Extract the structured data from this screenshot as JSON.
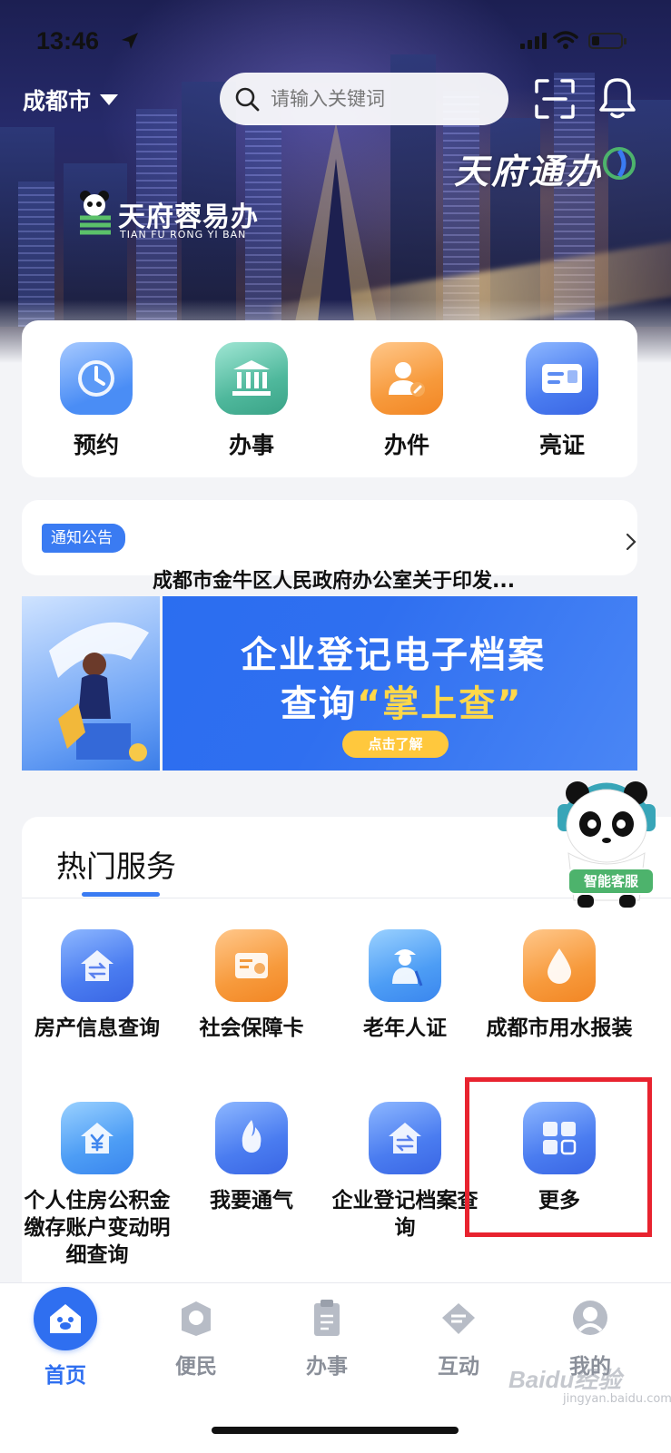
{
  "status_bar": {
    "time": "13:46",
    "battery_level": 0.25
  },
  "header": {
    "city": "成都市",
    "search_placeholder": "请输入关键词",
    "brand_logo": "天府通办",
    "sub_logo_main": "天府蓉易办",
    "sub_logo_sub": "TIAN FU RONG YI BAN"
  },
  "quick_actions": [
    {
      "label": "预约",
      "icon": "clock-icon",
      "color": "#4a8df5"
    },
    {
      "label": "办事",
      "icon": "bank-icon",
      "color": "#3fae8f"
    },
    {
      "label": "办件",
      "icon": "person-stamp-icon",
      "color": "#f28a2c"
    },
    {
      "label": "亮证",
      "icon": "id-card-icon",
      "color": "#4a7cf0"
    }
  ],
  "notice": {
    "badge": "通知公告",
    "text": "成都市金牛区人民政府办公室关于印发..."
  },
  "banner": {
    "line1": "企业登记电子档案",
    "line2_prefix": "查询",
    "line2_highlight": "“掌上查”",
    "button": "点击了解"
  },
  "hot_services": {
    "title": "热门服务",
    "items": [
      {
        "label": "房产信息查询",
        "icon": "house-exchange-icon"
      },
      {
        "label": "社会保障卡",
        "icon": "social-card-icon"
      },
      {
        "label": "老年人证",
        "icon": "elder-icon"
      },
      {
        "label": "成都市用水报装",
        "icon": "water-drop-icon"
      },
      {
        "label": "个人住房公积金缴存账户变动明细查询",
        "icon": "housing-fund-icon"
      },
      {
        "label": "我要通气",
        "icon": "gas-flame-icon"
      },
      {
        "label": "企业登记档案查询",
        "icon": "enterprise-exchange-icon"
      },
      {
        "label": "更多",
        "icon": "grid-more-icon"
      }
    ]
  },
  "assistant": {
    "label": "智能客服"
  },
  "tabbar": {
    "items": [
      {
        "label": "首页",
        "icon": "home-icon",
        "active": true
      },
      {
        "label": "便民",
        "icon": "convenience-icon",
        "active": false
      },
      {
        "label": "办事",
        "icon": "clipboard-icon",
        "active": false
      },
      {
        "label": "互动",
        "icon": "interact-icon",
        "active": false
      },
      {
        "label": "我的",
        "icon": "profile-icon",
        "active": false
      }
    ]
  },
  "watermark": {
    "main": "Baidu经验",
    "sub": "jingyan.baidu.com"
  },
  "colors": {
    "accent": "#2f6ff0",
    "highlight_border": "#e8232f",
    "background": "#f3f4f7"
  }
}
